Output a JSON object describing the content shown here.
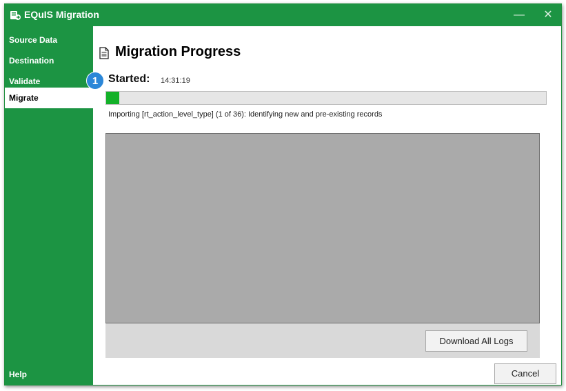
{
  "window": {
    "title": "EQuIS Migration",
    "minimize_glyph": "—",
    "close_glyph": "✕"
  },
  "sidebar": {
    "items": [
      {
        "label": "Source Data",
        "active": false
      },
      {
        "label": "Destination",
        "active": false
      },
      {
        "label": "Validate",
        "active": false
      },
      {
        "label": "Migrate",
        "active": true
      }
    ],
    "help_label": "Help"
  },
  "main": {
    "page_title": "Migration Progress",
    "step_number": "1",
    "started_label": "Started:",
    "started_time": "14:31:19",
    "progress_fraction": 0.03,
    "status_text": "Importing [rt_action_level_type] (1 of 36): Identifying new and pre-existing records",
    "download_button": "Download All Logs",
    "cancel_button": "Cancel"
  },
  "colors": {
    "brand_green": "#1c9443",
    "progress_green": "#13b129",
    "badge_blue": "#2b87d8",
    "log_gray": "#aaaaaa"
  }
}
